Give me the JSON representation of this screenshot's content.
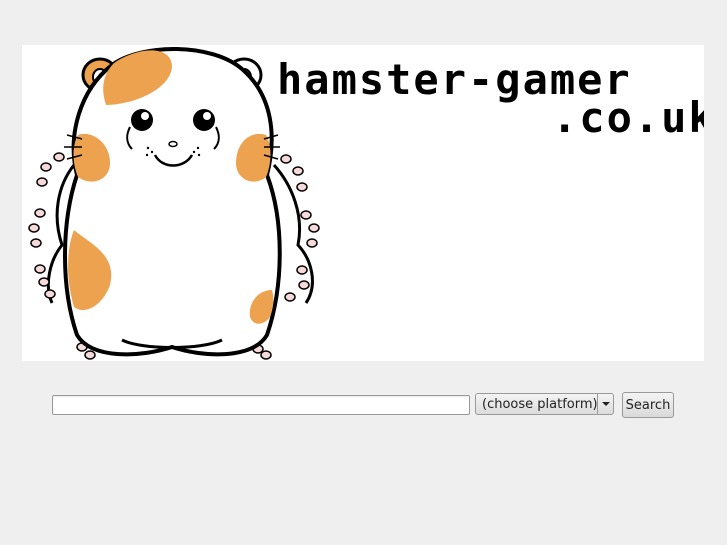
{
  "banner": {
    "logo_line1": "hamster-gamer",
    "logo_line2": ".co.uk",
    "mascot_icon": "hamster-mascot-icon",
    "colors": {
      "background": "#ffffff",
      "patch": "#eda24f",
      "toes": "#f7d9d9",
      "outline": "#000000"
    }
  },
  "search": {
    "input_value": "",
    "platform_selected": "(choose platform)",
    "button_label": "Search"
  },
  "page": {
    "background": "#efefef"
  }
}
